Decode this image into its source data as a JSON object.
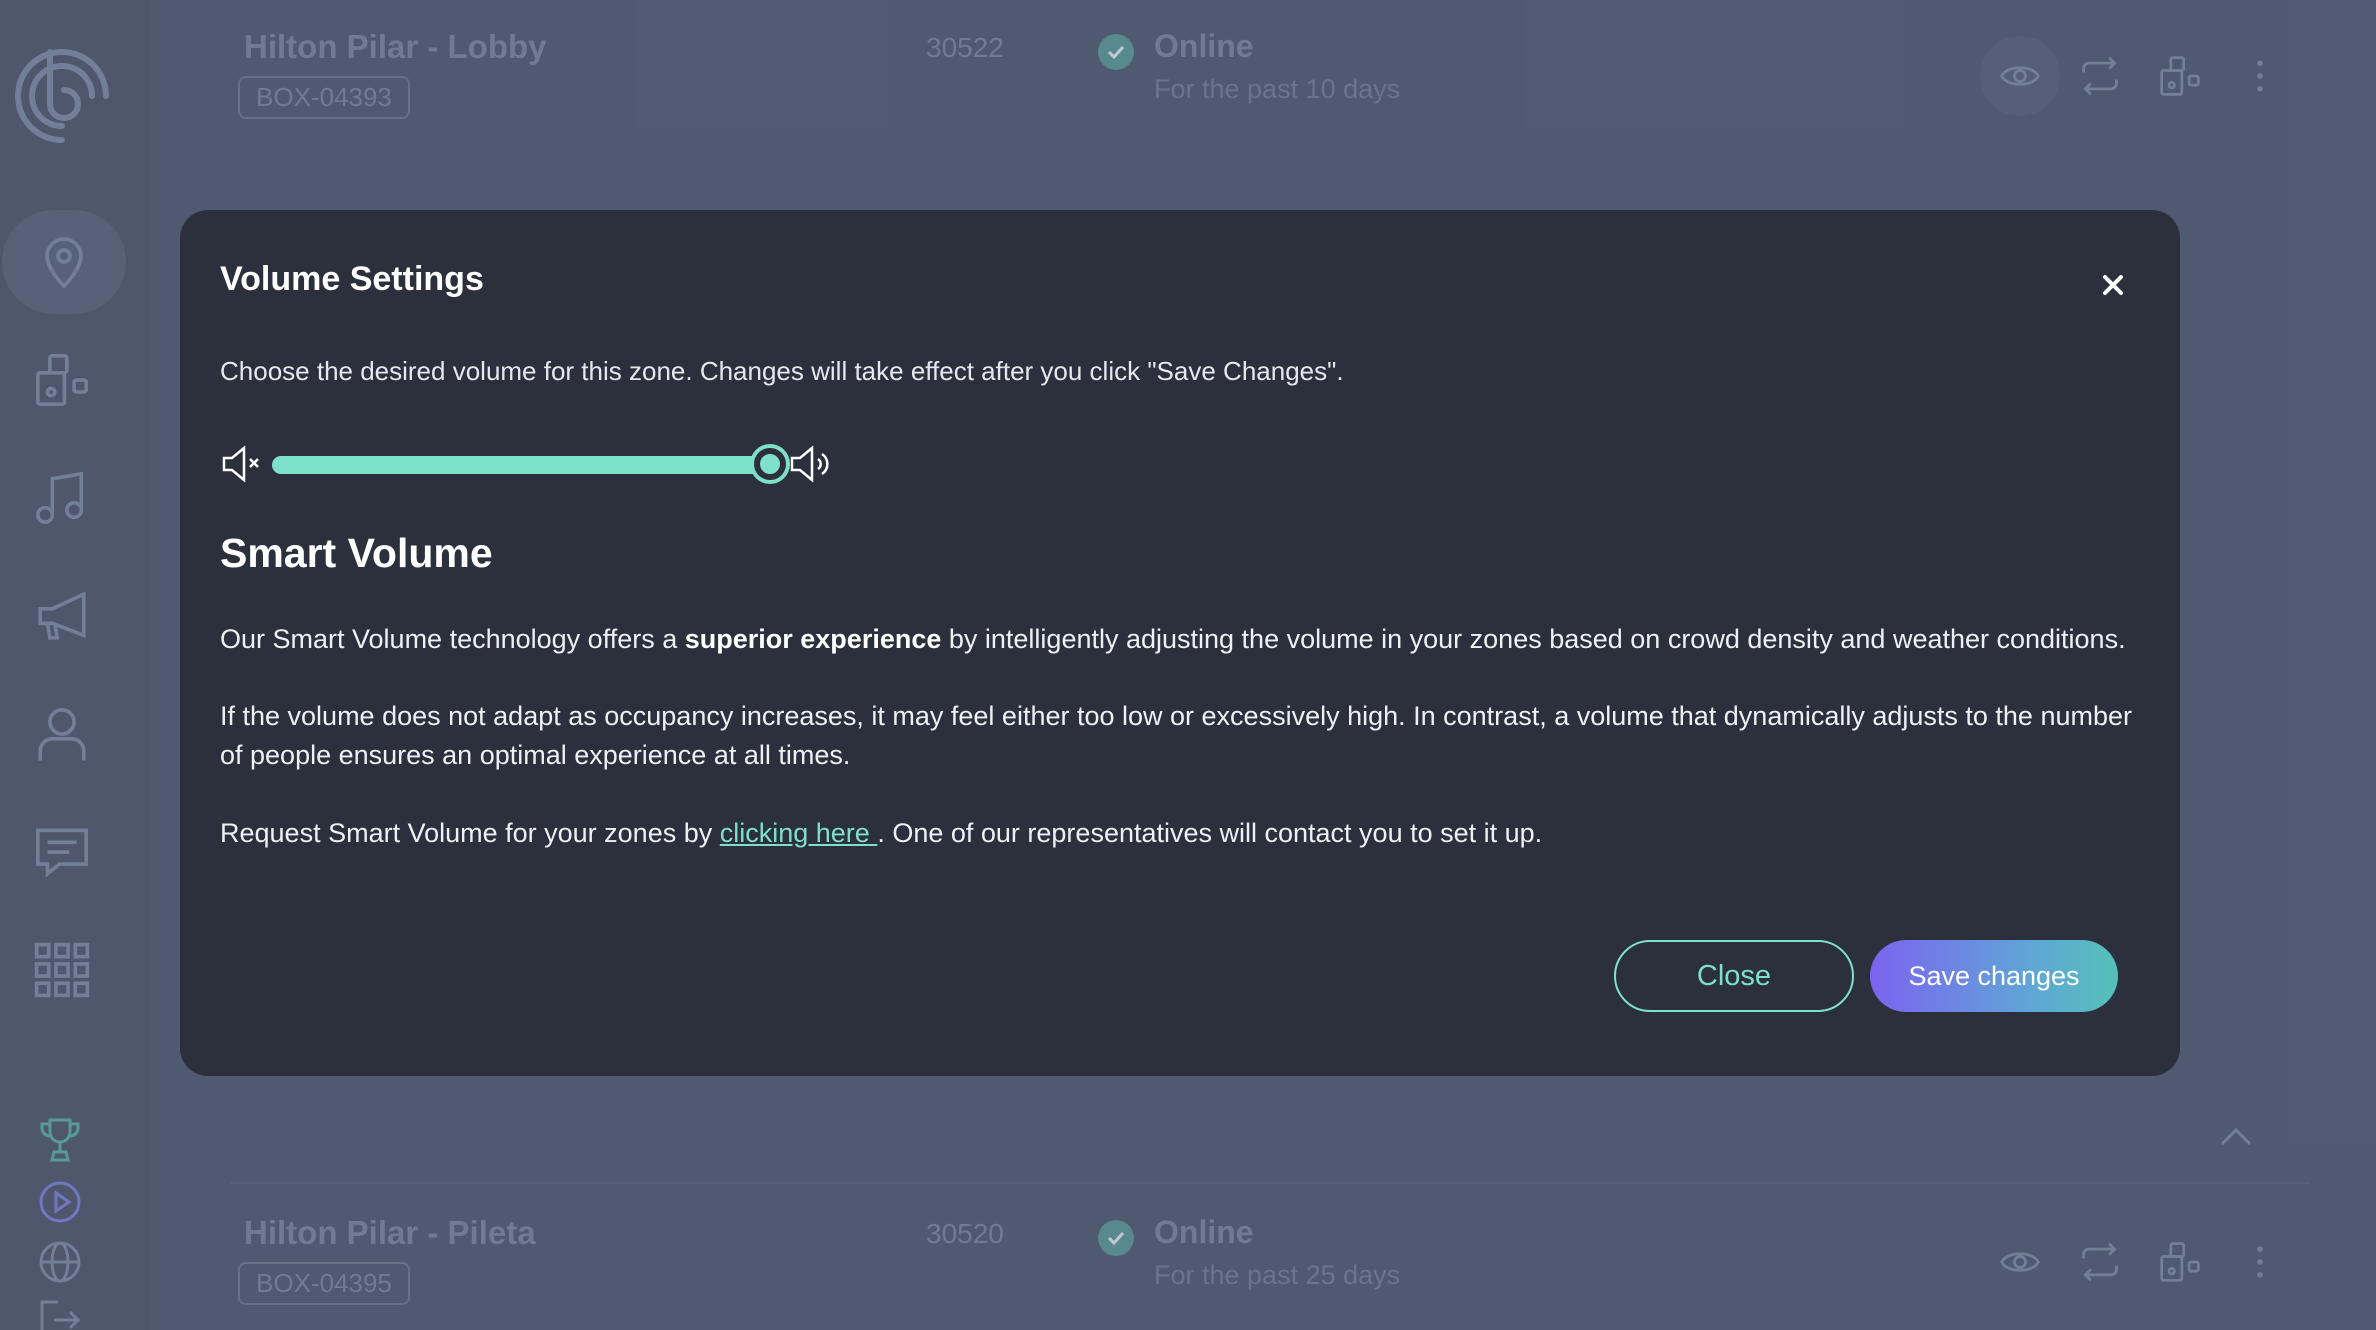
{
  "sidebar": {
    "items": [
      {
        "name": "location-pin-icon",
        "active": true
      },
      {
        "name": "devices-icon"
      },
      {
        "name": "music-note-icon"
      },
      {
        "name": "megaphone-icon"
      },
      {
        "name": "user-icon"
      },
      {
        "name": "chat-icon"
      },
      {
        "name": "grid-apps-icon"
      }
    ],
    "bottom_items": [
      "trophy-icon",
      "play-circle-icon",
      "globe-icon",
      "logout-icon"
    ]
  },
  "zones": [
    {
      "name": "Hilton Pilar - Lobby",
      "box": "BOX-04393",
      "number": "30522",
      "status": "Online",
      "since": "For the past 10 days"
    },
    {
      "name": "Hilton Pilar - Pileta",
      "box": "BOX-04395",
      "number": "30520",
      "status": "Online",
      "since": "For the past 25 days"
    }
  ],
  "modal": {
    "title": "Volume Settings",
    "description": "Choose the desired volume for this zone. Changes will take effect after you click \"Save Changes\".",
    "volume_level": 1.0,
    "smart_title": "Smart Volume",
    "para1_pre": "Our Smart Volume technology offers a ",
    "para1_bold": "superior experience",
    "para1_post": " by intelligently adjusting the volume in your zones based on crowd density and weather conditions.",
    "para2": "If the volume does not adapt as occupancy increases, it may feel either too low or excessively high. In contrast, a volume that dynamically adjusts to the number of people ensures an optimal experience at all times.",
    "para3_pre": "Request Smart Volume for your zones by ",
    "para3_link": "clicking here ",
    "para3_post": ". One of our representatives will contact you to set it up.",
    "close_label": "Close",
    "save_label": "Save changes"
  },
  "colors": {
    "accent": "#7de0c8",
    "modal_bg": "#2c303c",
    "save_gradient_start": "#7c63f0",
    "save_gradient_end": "#55c0b8"
  }
}
